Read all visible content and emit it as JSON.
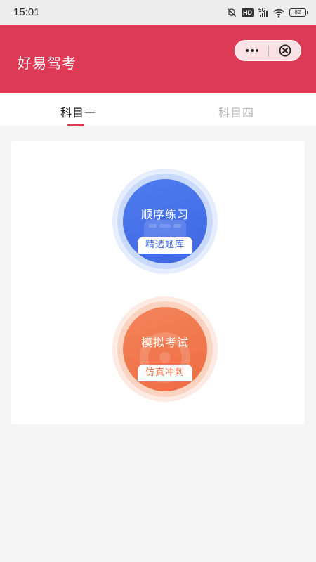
{
  "status_bar": {
    "time": "15:01",
    "hd": "HD",
    "network": "5G",
    "battery": "82",
    "icons": [
      "mute-bell-icon",
      "hd-icon",
      "signal-icon",
      "wifi-icon",
      "battery-icon"
    ]
  },
  "header": {
    "title": "好易驾考",
    "capsule": {
      "more_icon": "more-dots-icon",
      "close_icon": "close-circle-icon"
    },
    "color": "#dd3a55"
  },
  "tabs": [
    {
      "label": "科目一",
      "active": true
    },
    {
      "label": "科目四",
      "active": false
    }
  ],
  "actions": [
    {
      "title": "顺序练习",
      "subtitle": "精选题库",
      "color": "#3e66e0",
      "icon": "bus-icon"
    },
    {
      "title": "模拟考试",
      "subtitle": "仿真冲刺",
      "color": "#ee6c42",
      "icon": "steering-wheel-icon"
    }
  ]
}
